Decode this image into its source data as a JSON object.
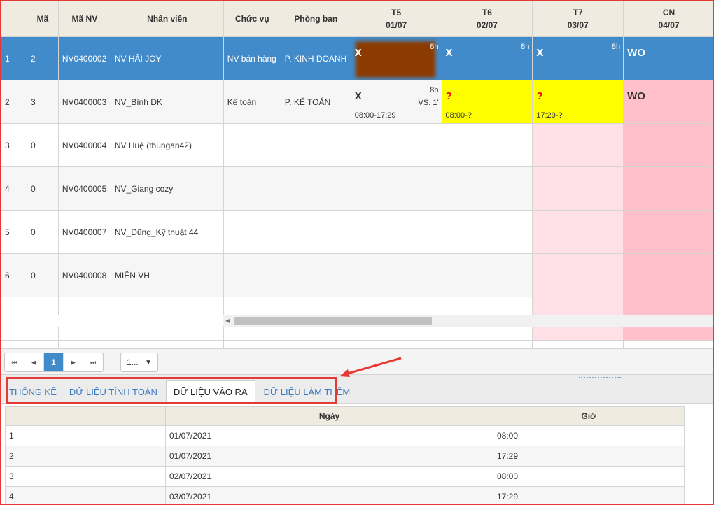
{
  "columns": {
    "index": "",
    "ma": "Mã",
    "ma_nv": "Mã NV",
    "nhan_vien": "Nhân viên",
    "chuc_vu": "Chức vụ",
    "phong_ban": "Phòng ban",
    "days": [
      {
        "dow": "T5",
        "date": "01/07"
      },
      {
        "dow": "T6",
        "date": "02/07"
      },
      {
        "dow": "T7",
        "date": "03/07"
      },
      {
        "dow": "CN",
        "date": "04/07"
      }
    ]
  },
  "rows": [
    {
      "idx": "1",
      "ma": "2",
      "ma_nv": "NV0400002",
      "name": "NV HẢI JOY",
      "chuc_vu": "NV bán hàng",
      "phong_ban": "P. KINH DOANH",
      "days": [
        {
          "mark": "X",
          "hours": "8h"
        },
        {
          "mark": "X",
          "hours": "8h"
        },
        {
          "mark": "X",
          "hours": "8h"
        },
        {
          "mark": "WO"
        }
      ]
    },
    {
      "idx": "2",
      "ma": "3",
      "ma_nv": "NV0400003",
      "name": "NV_Bình DK",
      "chuc_vu": "Kế toán",
      "phong_ban": "P. KẾ TOÁN",
      "days": [
        {
          "mark": "X",
          "hours": "8h",
          "vs": "VS: 1'",
          "time": "08:00-17:29"
        },
        {
          "mark": "?",
          "time": "08:00-?"
        },
        {
          "mark": "?",
          "time": "17:29-?"
        },
        {
          "mark": "WO"
        }
      ]
    },
    {
      "idx": "3",
      "ma": "0",
      "ma_nv": "NV0400004",
      "name": "NV Huệ (thungan42)",
      "chuc_vu": "",
      "phong_ban": ""
    },
    {
      "idx": "4",
      "ma": "0",
      "ma_nv": "NV0400005",
      "name": "NV_Giang cozy",
      "chuc_vu": "",
      "phong_ban": ""
    },
    {
      "idx": "5",
      "ma": "0",
      "ma_nv": "NV0400007",
      "name": "NV_Dũng_Kỹ thuật 44",
      "chuc_vu": "",
      "phong_ban": ""
    },
    {
      "idx": "6",
      "ma": "0",
      "ma_nv": "NV0400008",
      "name": "MIÊN VH",
      "chuc_vu": "",
      "phong_ban": ""
    }
  ],
  "pager": {
    "first": "⏮",
    "prev": "◀",
    "current": "1",
    "next": "▶",
    "last": "⏭",
    "page_size": "1...",
    "caret": "▼"
  },
  "tabs": [
    {
      "label": "THỐNG KÊ",
      "active": false
    },
    {
      "label": "DỮ LIỆU TÍNH TOÁN",
      "active": false
    },
    {
      "label": "DỮ LIỆU VÀO RA",
      "active": true
    },
    {
      "label": "DỮ LIỆU LÀM THÊM",
      "active": false
    }
  ],
  "io_table": {
    "headers": {
      "idx": "",
      "ngay": "Ngày",
      "gio": "Giờ"
    },
    "rows": [
      {
        "idx": "1",
        "ngay": "01/07/2021",
        "gio": "08:00"
      },
      {
        "idx": "2",
        "ngay": "01/07/2021",
        "gio": "17:29"
      },
      {
        "idx": "3",
        "ngay": "02/07/2021",
        "gio": "08:00"
      },
      {
        "idx": "4",
        "ngay": "03/07/2021",
        "gio": "17:29"
      }
    ]
  },
  "colors": {
    "selected_row": "#428bca",
    "absent_mark": "#ff0000",
    "missing_checkout": "#ffff00",
    "weekend_light": "#ffe0e6",
    "weekend": "#ffc0cb",
    "annotation": "#e53935"
  }
}
